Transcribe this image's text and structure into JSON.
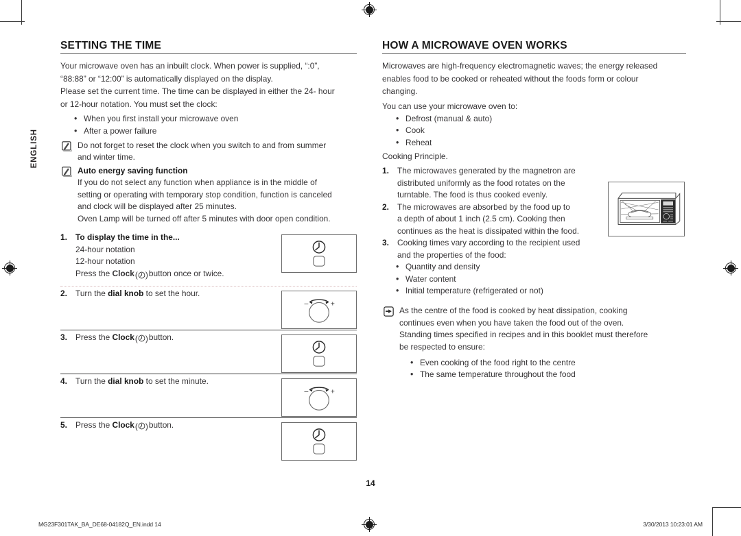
{
  "sidebar": {
    "language_tab": "ENGLISH"
  },
  "left": {
    "title": "SETTING THE TIME",
    "intro": [
      "Your microwave oven has an inbuilt clock. When power is supplied, “:0”,",
      "“88:88” or “12:00” is automatically displayed on the display.",
      "Please set the current time. The time can be displayed in either the 24- hour",
      "or 12-hour notation. You must set the clock:"
    ],
    "intro_bullets": [
      "When you first install your microwave oven",
      "After a power failure"
    ],
    "note1": [
      "Do not forget to reset the clock when you switch to and from summer",
      "and winter time."
    ],
    "note2_title": "Auto energy saving function",
    "note2": [
      "If you do not select any function when appliance is in the middle of",
      "setting or operating with temporary stop condition, function is canceled",
      "and clock will be displayed after 25 minutes.",
      "Oven Lamp will be turned off after 5 minutes with door open condition."
    ],
    "steps": [
      {
        "num": "1.",
        "lead_bold": "To display the time in the...",
        "lead_plain": "",
        "sub_lines": [
          "24-hour notation",
          "12-hour notation"
        ],
        "tail_pre": "Press the ",
        "tail_bold": "Clock",
        "tail_post": " () button once or twice.",
        "panel": "clock"
      },
      {
        "num": "2.",
        "lead_pre": "Turn the ",
        "lead_bold": "dial knob",
        "lead_post": " to set the hour.",
        "panel": "dial"
      },
      {
        "num": "3.",
        "lead_pre": "Press the ",
        "lead_bold": "Clock",
        "lead_post": " () button.",
        "panel": "clock"
      },
      {
        "num": "4.",
        "lead_pre": "Turn the ",
        "lead_bold": "dial knob",
        "lead_post": " to set the minute.",
        "panel": "dial"
      },
      {
        "num": "5.",
        "lead_pre": "Press the ",
        "lead_bold": "Clock",
        "lead_post": " () button.",
        "panel": "clock"
      }
    ],
    "dial_minus": "–",
    "dial_plus": "+"
  },
  "right": {
    "title": "HOW A MICROWAVE OVEN WORKS",
    "intro": [
      "Microwaves are high-frequency electromagnetic waves; the energy released",
      "enables food to be cooked or reheated without the foods form or colour",
      "changing."
    ],
    "use_lead": "You can use your microwave oven to:",
    "use_bullets": [
      "Defrost (manual & auto)",
      "Cook",
      "Reheat"
    ],
    "principle_lead": "Cooking Principle.",
    "numbered": [
      {
        "num": "1.",
        "lines": [
          "The microwaves generated by the magnetron are",
          "distributed uniformly as the food rotates on the",
          "turntable. The food is thus cooked evenly."
        ]
      },
      {
        "num": "2.",
        "lines": [
          "The microwaves are absorbed by the food up to",
          "a depth of about 1 inch (2.5 cm). Cooking then",
          "continues as the heat is dissipated within the food."
        ]
      },
      {
        "num": "3.",
        "lines": [
          "Cooking times vary according to the recipient used",
          "and the properties of the food:"
        ]
      }
    ],
    "prop_bullets": [
      "Quantity and density",
      "Water content",
      "Initial temperature (refrigerated or not)"
    ],
    "hand_note": [
      "As the centre of the food is cooked by heat dissipation, cooking",
      "continues even when you have taken the food out of the oven.",
      "Standing times specified in recipes and in this booklet must therefore",
      "be respected to ensure:"
    ],
    "hand_bullets": [
      "Even cooking of the food right to the centre",
      "The same temperature throughout the food"
    ]
  },
  "footer": {
    "page_number": "14",
    "file_name": "MG23F301TAK_BA_DE68-04182Q_EN.indd   14",
    "timestamp": "3/30/2013   10:23:01 AM"
  },
  "icons": {
    "memo": "memo-note-icon",
    "hand": "pointing-hand-icon",
    "clock": "clock-button-icon",
    "dial": "dial-knob-icon",
    "registration": "registration-mark-icon",
    "oven": "microwave-oven-illustration"
  },
  "colors": {
    "text": "#363436",
    "heading": "#1b1b1b",
    "rule": "#5a5a5a",
    "panel_border": "#6d6d6d"
  }
}
